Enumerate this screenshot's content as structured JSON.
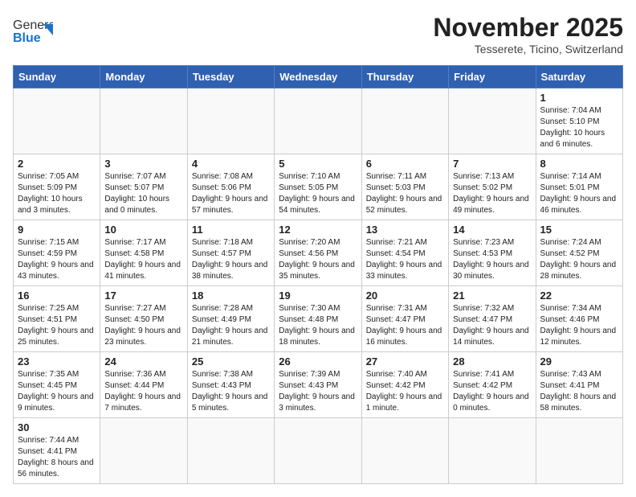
{
  "header": {
    "logo_general": "General",
    "logo_blue": "Blue",
    "month": "November 2025",
    "location": "Tesserete, Ticino, Switzerland"
  },
  "weekdays": [
    "Sunday",
    "Monday",
    "Tuesday",
    "Wednesday",
    "Thursday",
    "Friday",
    "Saturday"
  ],
  "weeks": [
    [
      {
        "day": "",
        "info": ""
      },
      {
        "day": "",
        "info": ""
      },
      {
        "day": "",
        "info": ""
      },
      {
        "day": "",
        "info": ""
      },
      {
        "day": "",
        "info": ""
      },
      {
        "day": "",
        "info": ""
      },
      {
        "day": "1",
        "info": "Sunrise: 7:04 AM\nSunset: 5:10 PM\nDaylight: 10 hours and 6 minutes."
      }
    ],
    [
      {
        "day": "2",
        "info": "Sunrise: 7:05 AM\nSunset: 5:09 PM\nDaylight: 10 hours and 3 minutes."
      },
      {
        "day": "3",
        "info": "Sunrise: 7:07 AM\nSunset: 5:07 PM\nDaylight: 10 hours and 0 minutes."
      },
      {
        "day": "4",
        "info": "Sunrise: 7:08 AM\nSunset: 5:06 PM\nDaylight: 9 hours and 57 minutes."
      },
      {
        "day": "5",
        "info": "Sunrise: 7:10 AM\nSunset: 5:05 PM\nDaylight: 9 hours and 54 minutes."
      },
      {
        "day": "6",
        "info": "Sunrise: 7:11 AM\nSunset: 5:03 PM\nDaylight: 9 hours and 52 minutes."
      },
      {
        "day": "7",
        "info": "Sunrise: 7:13 AM\nSunset: 5:02 PM\nDaylight: 9 hours and 49 minutes."
      },
      {
        "day": "8",
        "info": "Sunrise: 7:14 AM\nSunset: 5:01 PM\nDaylight: 9 hours and 46 minutes."
      }
    ],
    [
      {
        "day": "9",
        "info": "Sunrise: 7:15 AM\nSunset: 4:59 PM\nDaylight: 9 hours and 43 minutes."
      },
      {
        "day": "10",
        "info": "Sunrise: 7:17 AM\nSunset: 4:58 PM\nDaylight: 9 hours and 41 minutes."
      },
      {
        "day": "11",
        "info": "Sunrise: 7:18 AM\nSunset: 4:57 PM\nDaylight: 9 hours and 38 minutes."
      },
      {
        "day": "12",
        "info": "Sunrise: 7:20 AM\nSunset: 4:56 PM\nDaylight: 9 hours and 35 minutes."
      },
      {
        "day": "13",
        "info": "Sunrise: 7:21 AM\nSunset: 4:54 PM\nDaylight: 9 hours and 33 minutes."
      },
      {
        "day": "14",
        "info": "Sunrise: 7:23 AM\nSunset: 4:53 PM\nDaylight: 9 hours and 30 minutes."
      },
      {
        "day": "15",
        "info": "Sunrise: 7:24 AM\nSunset: 4:52 PM\nDaylight: 9 hours and 28 minutes."
      }
    ],
    [
      {
        "day": "16",
        "info": "Sunrise: 7:25 AM\nSunset: 4:51 PM\nDaylight: 9 hours and 25 minutes."
      },
      {
        "day": "17",
        "info": "Sunrise: 7:27 AM\nSunset: 4:50 PM\nDaylight: 9 hours and 23 minutes."
      },
      {
        "day": "18",
        "info": "Sunrise: 7:28 AM\nSunset: 4:49 PM\nDaylight: 9 hours and 21 minutes."
      },
      {
        "day": "19",
        "info": "Sunrise: 7:30 AM\nSunset: 4:48 PM\nDaylight: 9 hours and 18 minutes."
      },
      {
        "day": "20",
        "info": "Sunrise: 7:31 AM\nSunset: 4:47 PM\nDaylight: 9 hours and 16 minutes."
      },
      {
        "day": "21",
        "info": "Sunrise: 7:32 AM\nSunset: 4:47 PM\nDaylight: 9 hours and 14 minutes."
      },
      {
        "day": "22",
        "info": "Sunrise: 7:34 AM\nSunset: 4:46 PM\nDaylight: 9 hours and 12 minutes."
      }
    ],
    [
      {
        "day": "23",
        "info": "Sunrise: 7:35 AM\nSunset: 4:45 PM\nDaylight: 9 hours and 9 minutes."
      },
      {
        "day": "24",
        "info": "Sunrise: 7:36 AM\nSunset: 4:44 PM\nDaylight: 9 hours and 7 minutes."
      },
      {
        "day": "25",
        "info": "Sunrise: 7:38 AM\nSunset: 4:43 PM\nDaylight: 9 hours and 5 minutes."
      },
      {
        "day": "26",
        "info": "Sunrise: 7:39 AM\nSunset: 4:43 PM\nDaylight: 9 hours and 3 minutes."
      },
      {
        "day": "27",
        "info": "Sunrise: 7:40 AM\nSunset: 4:42 PM\nDaylight: 9 hours and 1 minute."
      },
      {
        "day": "28",
        "info": "Sunrise: 7:41 AM\nSunset: 4:42 PM\nDaylight: 9 hours and 0 minutes."
      },
      {
        "day": "29",
        "info": "Sunrise: 7:43 AM\nSunset: 4:41 PM\nDaylight: 8 hours and 58 minutes."
      }
    ],
    [
      {
        "day": "30",
        "info": "Sunrise: 7:44 AM\nSunset: 4:41 PM\nDaylight: 8 hours and 56 minutes."
      },
      {
        "day": "",
        "info": ""
      },
      {
        "day": "",
        "info": ""
      },
      {
        "day": "",
        "info": ""
      },
      {
        "day": "",
        "info": ""
      },
      {
        "day": "",
        "info": ""
      },
      {
        "day": "",
        "info": ""
      }
    ]
  ]
}
